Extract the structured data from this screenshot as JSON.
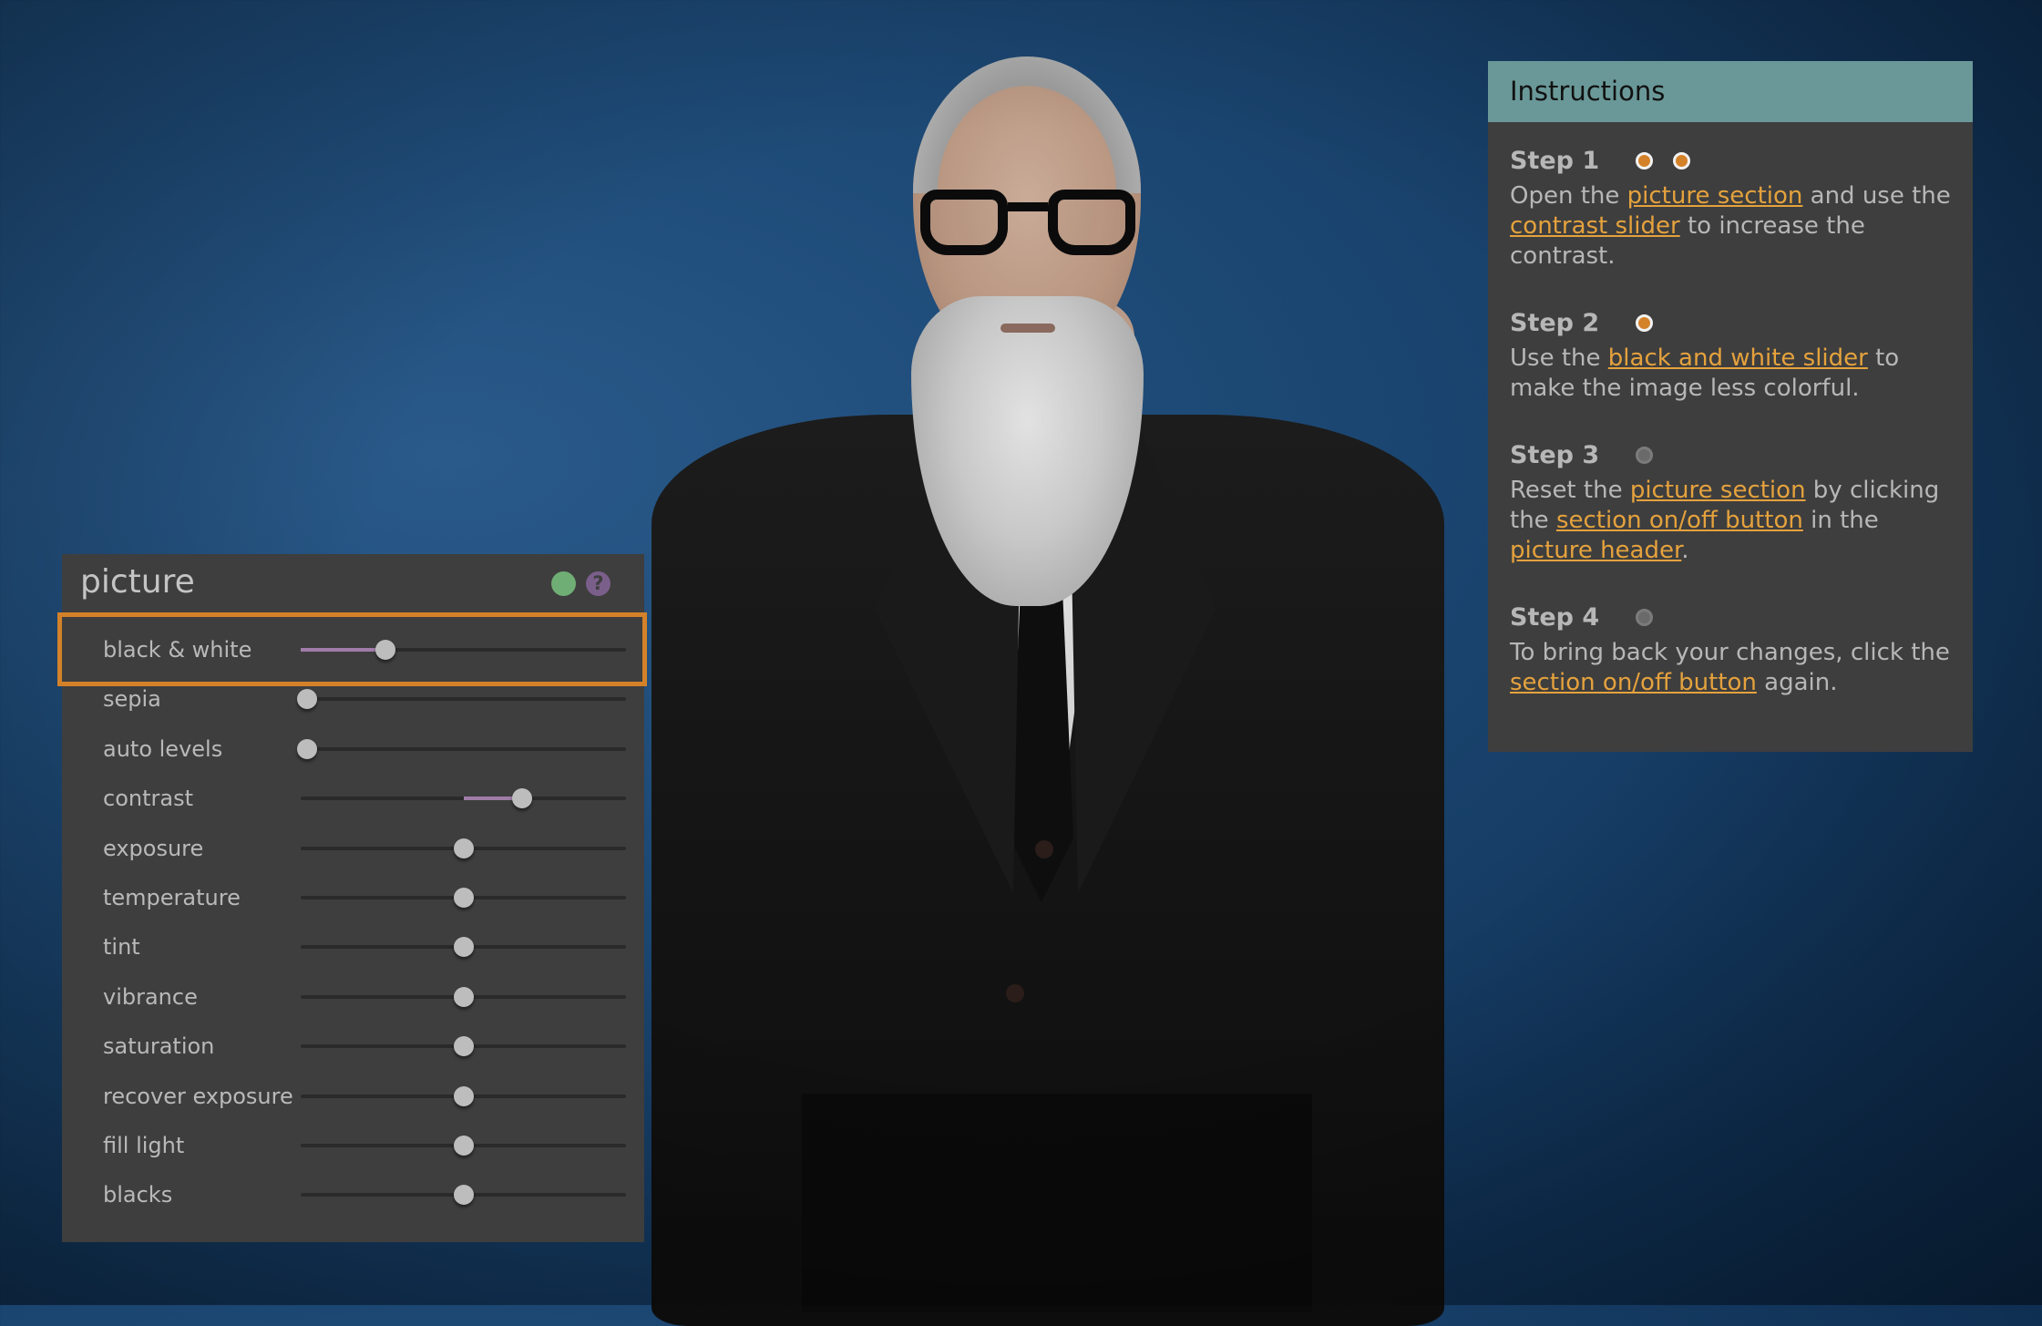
{
  "picture_panel": {
    "title": "picture",
    "onoff_icon": "power-toggle-dot",
    "help_icon": "question-mark",
    "help_glyph": "?",
    "highlighted_row": "black & white",
    "sliders": [
      {
        "label": "black & white",
        "value": 0.26,
        "fill_from": 0.0
      },
      {
        "label": "sepia",
        "value": 0.02,
        "fill_from": 0.0
      },
      {
        "label": "auto levels",
        "value": 0.02,
        "fill_from": 0.0
      },
      {
        "label": "contrast",
        "value": 0.68,
        "fill_from": 0.5
      },
      {
        "label": "exposure",
        "value": 0.5,
        "fill_from": 0.5
      },
      {
        "label": "temperature",
        "value": 0.5,
        "fill_from": 0.5
      },
      {
        "label": "tint",
        "value": 0.5,
        "fill_from": 0.5
      },
      {
        "label": "vibrance",
        "value": 0.5,
        "fill_from": 0.5
      },
      {
        "label": "saturation",
        "value": 0.5,
        "fill_from": 0.5
      },
      {
        "label": "recover exposure",
        "value": 0.5,
        "fill_from": 0.5
      },
      {
        "label": "fill light",
        "value": 0.5,
        "fill_from": 0.5
      },
      {
        "label": "blacks",
        "value": 0.5,
        "fill_from": 0.5
      }
    ]
  },
  "instructions": {
    "title": "Instructions",
    "steps": [
      {
        "title": "Step 1",
        "status": [
          "done",
          "done"
        ],
        "text": [
          {
            "t": "Open the "
          },
          {
            "link": "picture section"
          },
          {
            "t": " and use the "
          },
          {
            "link": "contrast slider"
          },
          {
            "t": " to increase the contrast."
          }
        ]
      },
      {
        "title": "Step 2",
        "status": [
          "done"
        ],
        "text": [
          {
            "t": "Use the "
          },
          {
            "link": "black and white slider"
          },
          {
            "t": " to make the image less colorful."
          }
        ]
      },
      {
        "title": "Step 3",
        "status": [
          "todo"
        ],
        "text": [
          {
            "t": "Reset the "
          },
          {
            "link": "picture section"
          },
          {
            "t": " by clicking the "
          },
          {
            "link": "section on/off button"
          },
          {
            "t": " in the "
          },
          {
            "link": "picture header"
          },
          {
            "t": "."
          }
        ]
      },
      {
        "title": "Step 4",
        "status": [
          "todo"
        ],
        "text": [
          {
            "t": "To bring back your changes, click the "
          },
          {
            "link": "section on/off button"
          },
          {
            "t": " again."
          }
        ]
      }
    ]
  },
  "colors": {
    "accent_orange": "#d4822a",
    "link_orange": "#e5a23d",
    "slider_fill": "#a07ca8",
    "onoff_green": "#6fae74",
    "help_purple": "#7b5f8b",
    "instructions_header": "#6a9898",
    "panel_bg": "#3e3e3e"
  },
  "background_image": {
    "subject": "bearded man with glasses in black suit against blue backdrop"
  }
}
